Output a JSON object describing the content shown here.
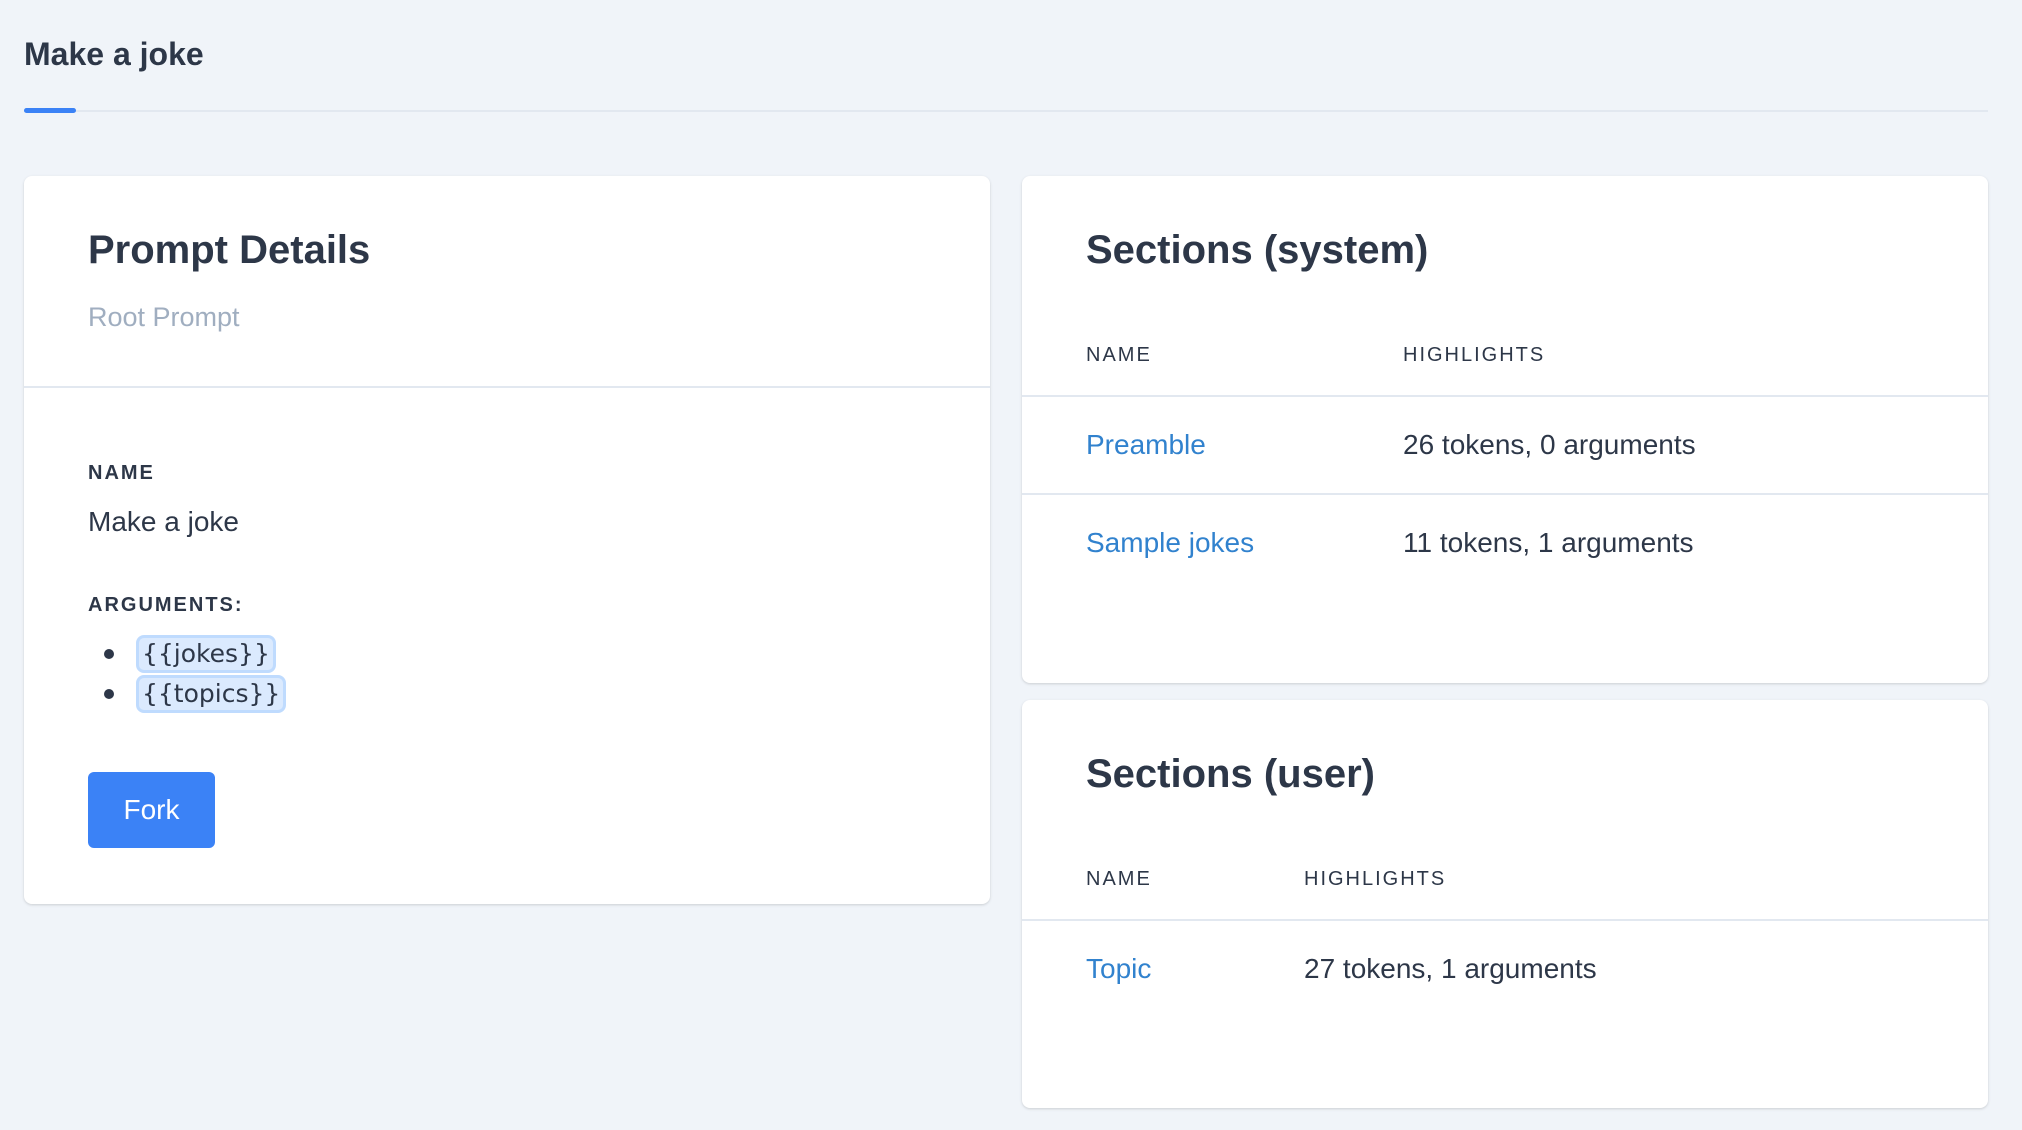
{
  "page": {
    "title": "Make a joke"
  },
  "colors": {
    "accent": "#3b82f6",
    "link": "#3182ce",
    "background": "#f0f4f9",
    "chip_bg": "#dbeafe"
  },
  "details": {
    "heading": "Prompt Details",
    "subtitle": "Root Prompt",
    "name_label": "NAME",
    "name_value": "Make a joke",
    "arguments_label": "ARGUMENTS:",
    "arguments": [
      "{{jokes}}",
      "{{topics}}"
    ],
    "fork_label": "Fork"
  },
  "system_sections": {
    "heading": "Sections (system)",
    "col_name": "NAME",
    "col_highlights": "HIGHLIGHTS",
    "rows": [
      {
        "name": "Preamble",
        "highlights": "26 tokens, 0 arguments"
      },
      {
        "name": "Sample jokes",
        "highlights": "11 tokens, 1 arguments"
      }
    ]
  },
  "user_sections": {
    "heading": "Sections (user)",
    "col_name": "NAME",
    "col_highlights": "HIGHLIGHTS",
    "rows": [
      {
        "name": "Topic",
        "highlights": "27 tokens, 1 arguments"
      }
    ]
  }
}
